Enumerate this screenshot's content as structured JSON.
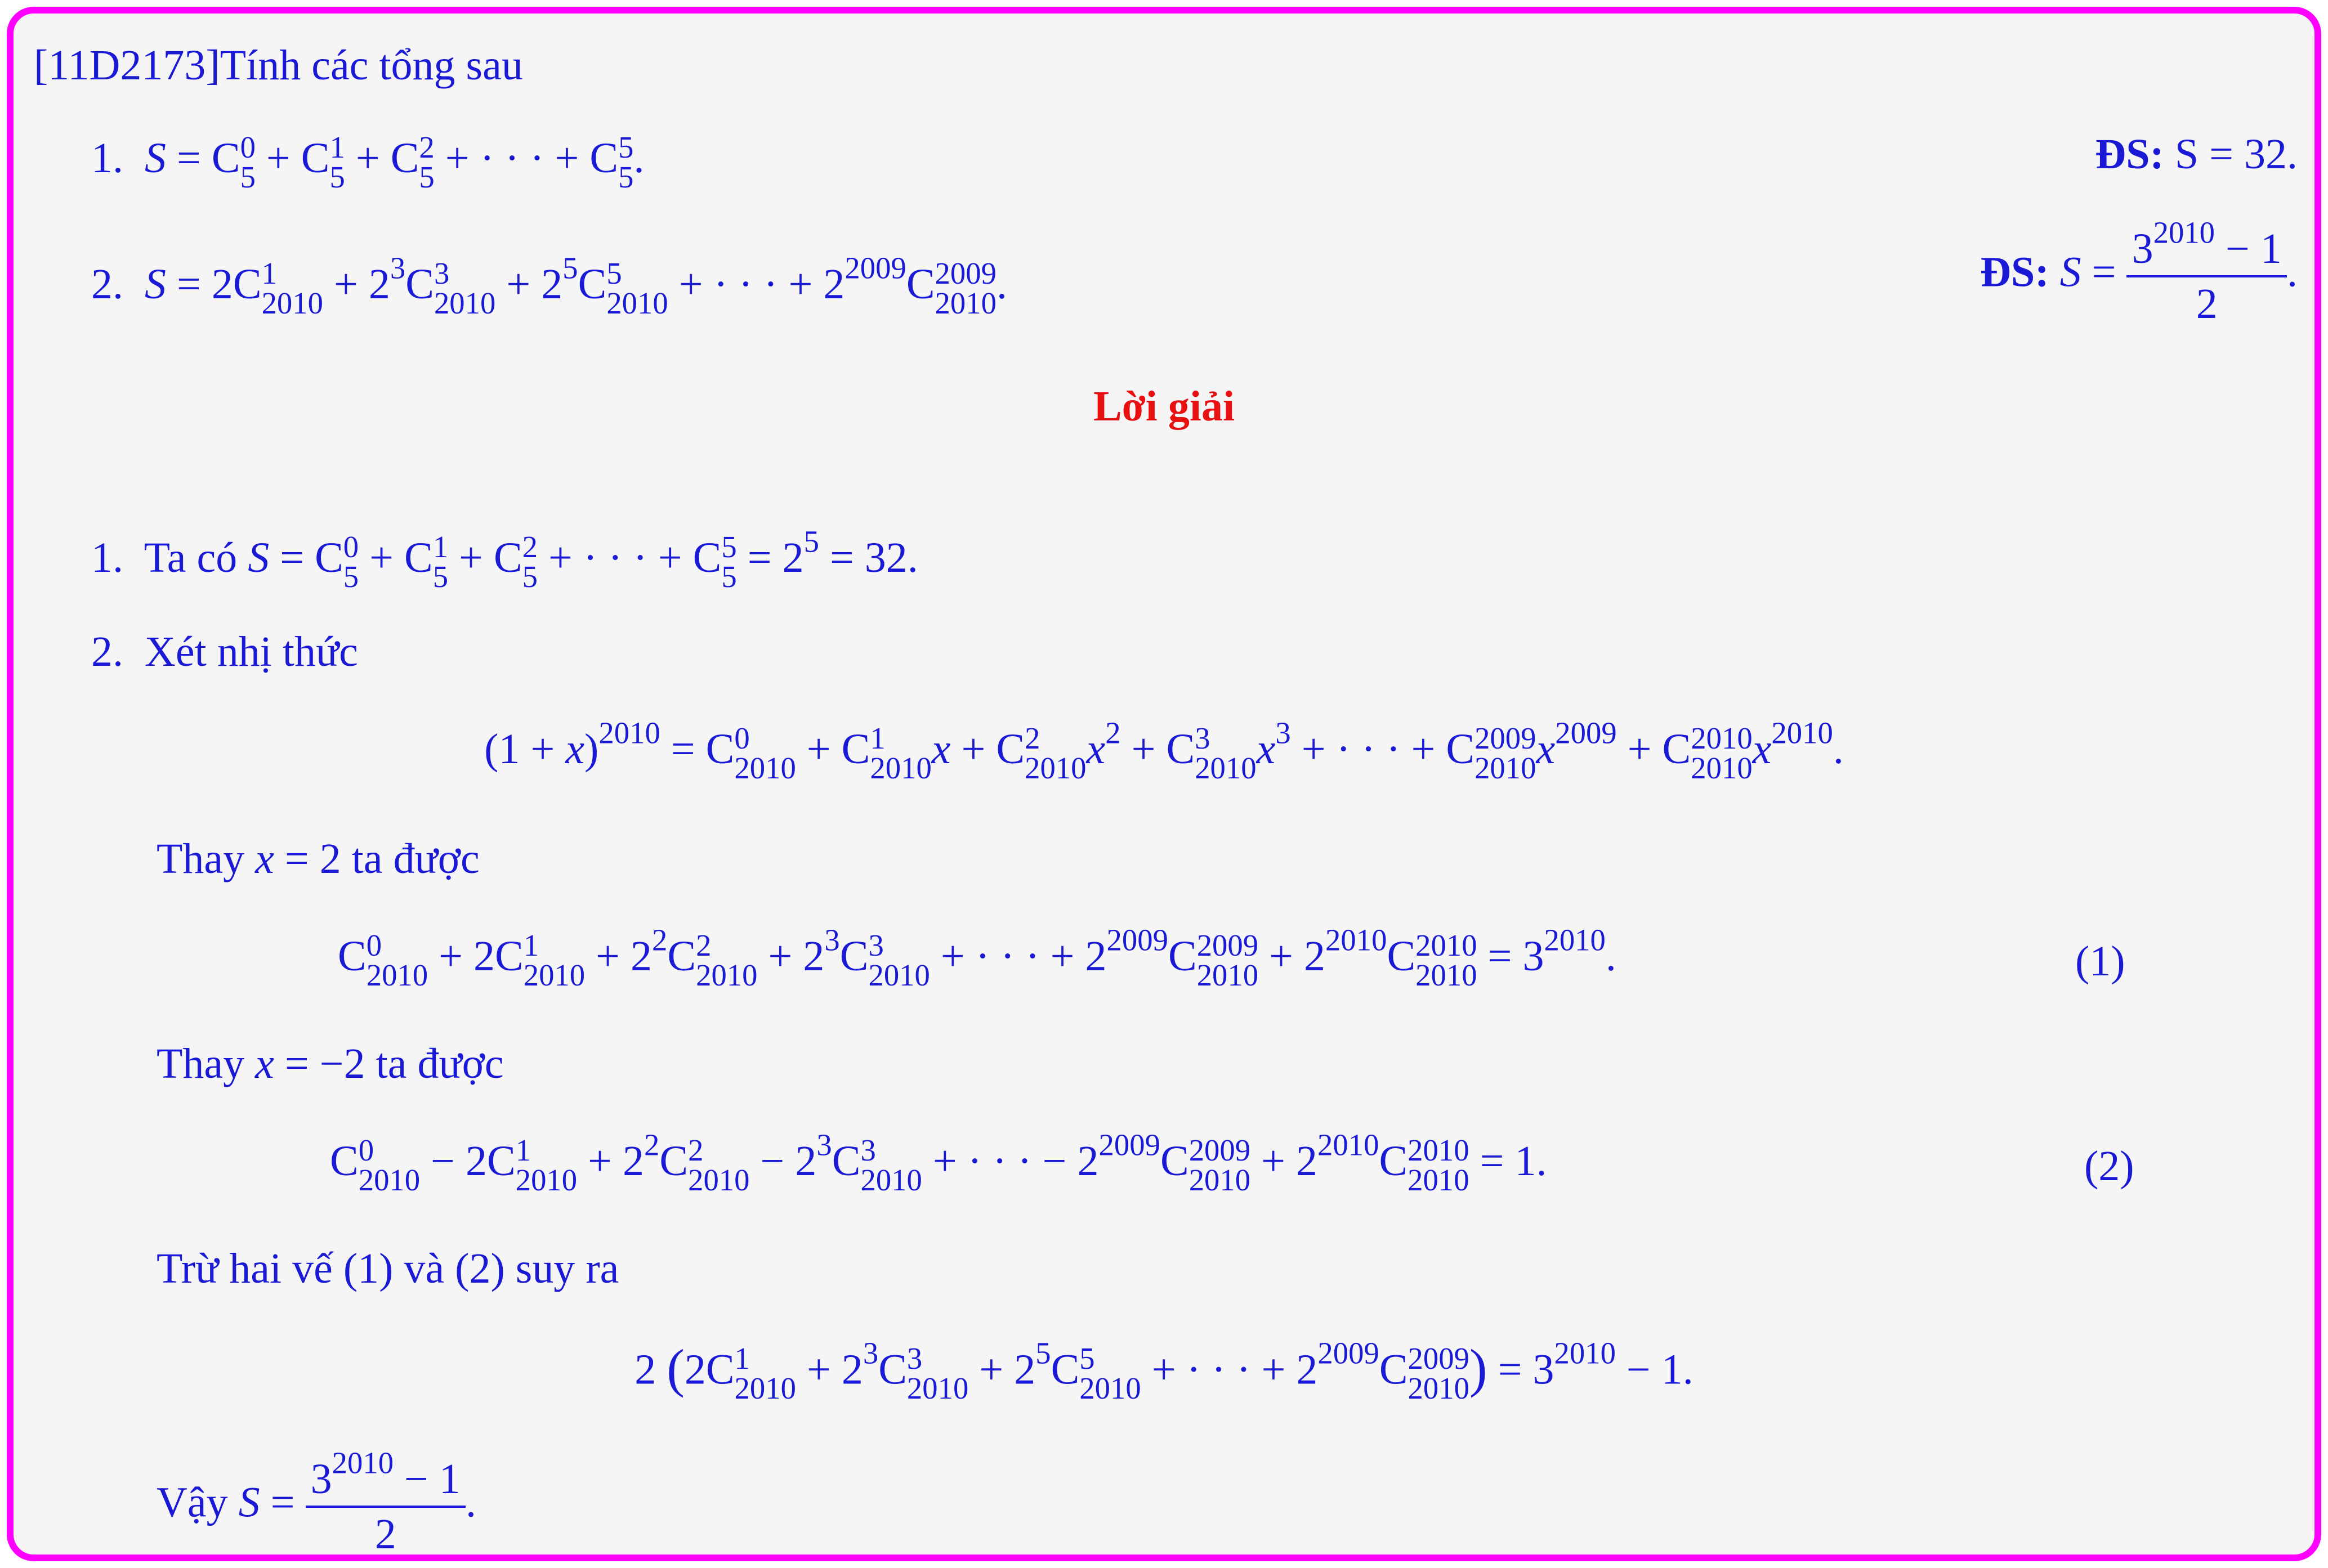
{
  "header": {
    "label": "[11D2173]Tính các tổng sau"
  },
  "problems": [
    {
      "num": "1.",
      "answer_label": "ĐS:",
      "answer_value": "S = 32."
    },
    {
      "num": "2.",
      "answer_label": "ĐS:"
    }
  ],
  "solution": {
    "title": "Lời giải",
    "step1_num": "1.",
    "step1_prefix": "Ta có",
    "step2_num": "2.",
    "step2_intro": "Xét nhị thức",
    "sub_pos_text": "Thay",
    "sub_pos_tail": "ta được",
    "sub_neg_text": "Thay",
    "sub_neg_tail": "ta được",
    "eq1_label": "(1)",
    "eq2_label": "(2)",
    "subtract_text": "Trừ hai vế (1) và (2) suy ra",
    "conclusion_prefix": "Vậy"
  },
  "colors": {
    "frame": "#ff00ff",
    "text": "#1a1ad6",
    "title": "#e81010",
    "background": "#f5f5f5"
  }
}
